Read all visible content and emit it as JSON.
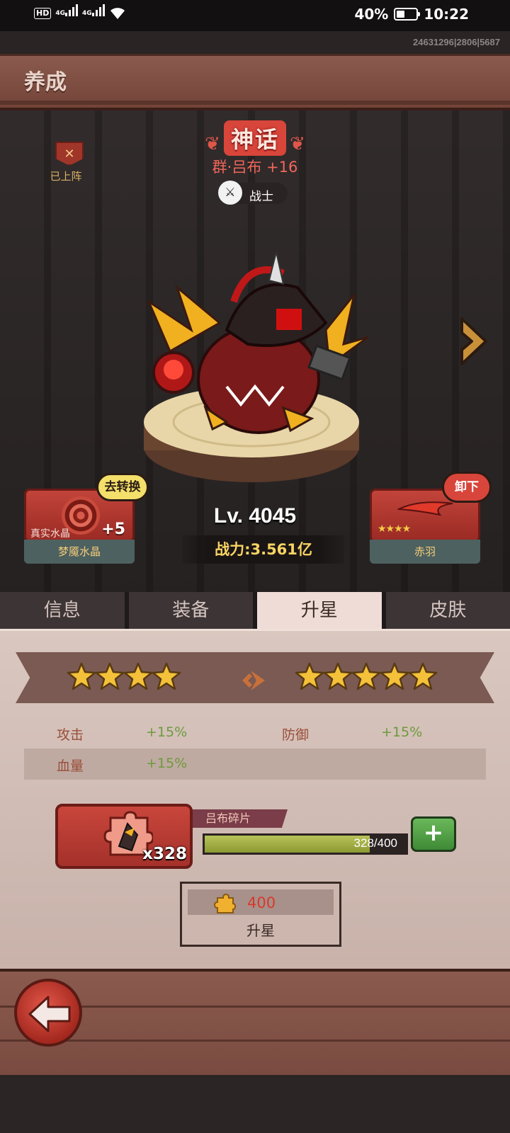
{
  "status_bar": {
    "net_hd": "HD",
    "net_1": "4G",
    "net_2": "4G",
    "battery": "40%",
    "time": "10:22"
  },
  "build_id": "24631296|2806|5687",
  "title": "养成",
  "hero": {
    "rarity": "神话",
    "name": "群·吕布 +16",
    "class": "战士",
    "deploy_status": "已上阵",
    "level": "Lv. 4045",
    "power": "战力:3.561亿"
  },
  "left_slot": {
    "bubble": "去转换",
    "sub_label": "真实水晶",
    "plus": "+5",
    "name": "梦魇水晶"
  },
  "right_slot": {
    "bubble": "卸下",
    "name": "赤羽",
    "stars": 4
  },
  "tabs": [
    "信息",
    "装备",
    "升星",
    "皮肤"
  ],
  "active_tab": "升星",
  "star_up": {
    "current_stars": 4,
    "next_stars": 5,
    "stats": [
      {
        "label": "攻击",
        "value": "+15%"
      },
      {
        "label": "防御",
        "value": "+15%"
      },
      {
        "label": "血量",
        "value": "+15%"
      }
    ],
    "shard_name": "吕布碎片",
    "shard_count": "x328",
    "progress_text": "328/400",
    "progress": 0.82,
    "cost": "400",
    "button_label": "升星"
  },
  "colors": {
    "accent_red": "#d8453b",
    "gold": "#f3cb45",
    "stat_green": "#6e9a3c"
  }
}
